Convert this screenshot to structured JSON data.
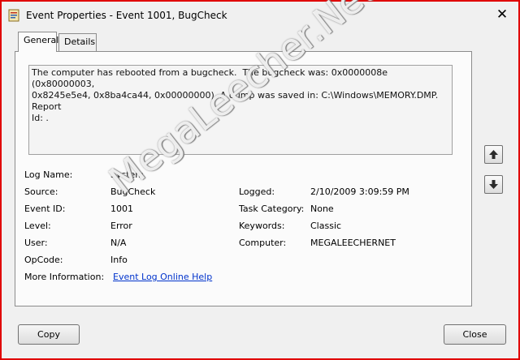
{
  "window": {
    "title": "Event Properties - Event 1001, BugCheck",
    "close_glyph": "✕"
  },
  "tabs": [
    {
      "label": "General",
      "active": true
    },
    {
      "label": "Details",
      "active": false
    }
  ],
  "description": "The computer has rebooted from a bugcheck.  The bugcheck was: 0x0000008e (0x80000003,\n0x8245e5e4, 0x8ba4ca44, 0x00000000). A dump was saved in: C:\\Windows\\MEMORY.DMP. Report\nId: .",
  "fields": {
    "log_name": {
      "label": "Log Name:",
      "value": "System"
    },
    "source": {
      "label": "Source:",
      "value": "BugCheck"
    },
    "event_id": {
      "label": "Event ID:",
      "value": "1001"
    },
    "level": {
      "label": "Level:",
      "value": "Error"
    },
    "user": {
      "label": "User:",
      "value": "N/A"
    },
    "opcode": {
      "label": "OpCode:",
      "value": "Info"
    },
    "more_info": {
      "label": "More Information:",
      "value": "Event Log Online Help"
    },
    "logged": {
      "label": "Logged:",
      "value": "2/10/2009 3:09:59 PM"
    },
    "task_category": {
      "label": "Task Category:",
      "value": "None"
    },
    "keywords": {
      "label": "Keywords:",
      "value": "Classic"
    },
    "computer": {
      "label": "Computer:",
      "value": "MEGALEECHERNET"
    }
  },
  "buttons": {
    "copy": "Copy",
    "close": "Close",
    "up_icon": "up-arrow-icon",
    "down_icon": "down-arrow-icon"
  },
  "watermark": "MegaLeecher.Net",
  "colors": {
    "border_accent": "#e00000",
    "link": "#0033cc"
  }
}
